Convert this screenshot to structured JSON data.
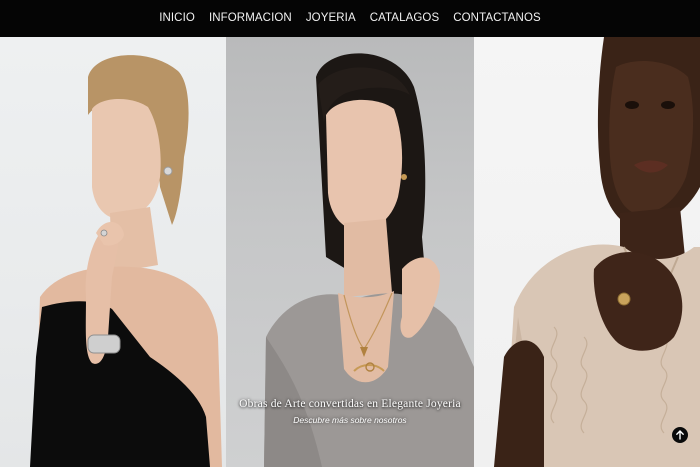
{
  "nav": {
    "items": [
      {
        "label": "INICIO"
      },
      {
        "label": "INFORMACION"
      },
      {
        "label": "JOYERIA"
      },
      {
        "label": "CATALAGOS"
      },
      {
        "label": "CONTACTANOS"
      }
    ]
  },
  "hero": {
    "title": "Obras de Arte convertidas en Elegante Joyeria",
    "link_label": "Descubre más sobre nosotros"
  },
  "scroll_top": {
    "icon": "arrow-up-icon"
  },
  "colors": {
    "nav_background": "#050505",
    "nav_text": "#f2f2f2",
    "caption_text": "#ffffff",
    "scroll_button": "#0a0a0a"
  }
}
